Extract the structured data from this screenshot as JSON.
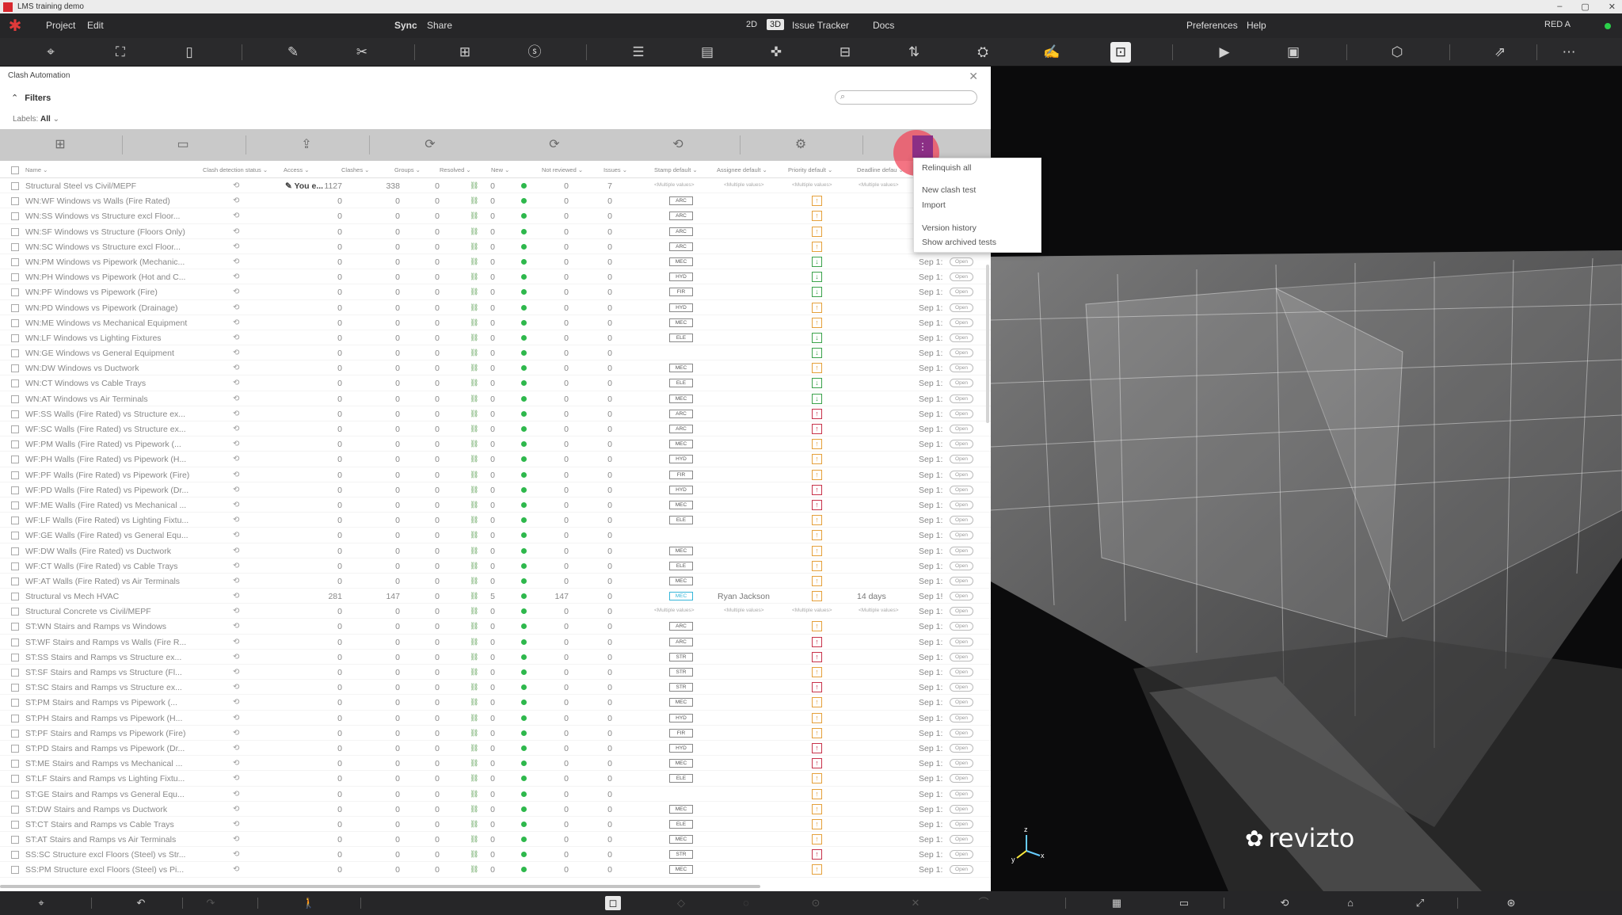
{
  "window": {
    "title": "LMS training demo",
    "controls": [
      "–",
      "▢",
      "✕"
    ]
  },
  "menubar": {
    "left": [
      "Project",
      "Edit"
    ],
    "center": [
      "Sync",
      "Share"
    ],
    "mode": [
      "2D",
      "3D"
    ],
    "nav": [
      "Issue Tracker",
      "Docs"
    ],
    "right": [
      "Preferences",
      "Help"
    ],
    "user": "RED A"
  },
  "toolbar": {
    "icons": [
      "map-pin-icon",
      "map-icon",
      "sheet-icon",
      "ruler-icon",
      "scissors-icon",
      "add-view-icon",
      "st-icon",
      "stack-icon",
      "list-icon",
      "gamepad-icon",
      "issues-icon",
      "sort-icon",
      "bucket-icon",
      "markup-icon",
      "clash-icon",
      "presentation-icon",
      "camera-icon",
      "cube-icon",
      "export-icon",
      "more-icon"
    ],
    "glyphs": [
      "⌖",
      "⛶",
      "▯",
      "✎",
      "✂",
      "⊞",
      "ⓢ",
      "☰",
      "▤",
      "✜",
      "⊟",
      "⇅",
      "⛭",
      "✍",
      "⊡",
      "▶",
      "▣",
      "⬡",
      "⇗",
      "⋯"
    ]
  },
  "panel": {
    "title": "Clash Automation",
    "filters_label": "Filters",
    "labels_prefix": "Labels:",
    "labels_value": "All",
    "search_placeholder": "",
    "columns": [
      "Name",
      "Clash detection status",
      "Access",
      "Clashes",
      "Groups",
      "Resolved",
      "New",
      "Not reviewed",
      "Issues",
      "Stamp default",
      "Assignee default",
      "Priority default",
      "Deadline defau"
    ]
  },
  "dropdown": {
    "items": [
      "Relinquish all",
      "New clash test",
      "Import",
      "Version history",
      "Show archived tests"
    ]
  },
  "rows": [
    {
      "name": "Structural Steel vs Civil/MEPF",
      "access": "You e...",
      "clashes": "1127",
      "groups": "338",
      "resolved": "0",
      "new": "0",
      "notrev": "0",
      "issues": "7",
      "stamp": "<Multiple values>",
      "assignee": "<Multiple values>",
      "priority": "mult",
      "deadline": "<Multiple values>",
      "date": "",
      "status": ""
    },
    {
      "name": "WN:WF Windows vs Walls (Fire Rated)",
      "clashes": "0",
      "groups": "0",
      "resolved": "0",
      "new": "0",
      "notrev": "0",
      "issues": "0",
      "stamp": "ARC",
      "priority": "up"
    },
    {
      "name": "WN:SS Windows vs Structure excl Floor...",
      "clashes": "0",
      "groups": "0",
      "resolved": "0",
      "new": "0",
      "notrev": "0",
      "issues": "0",
      "stamp": "ARC",
      "priority": "up"
    },
    {
      "name": "WN:SF Windows vs Structure (Floors Only)",
      "clashes": "0",
      "groups": "0",
      "resolved": "0",
      "new": "0",
      "notrev": "0",
      "issues": "0",
      "stamp": "ARC",
      "priority": "up"
    },
    {
      "name": "WN:SC Windows vs Structure excl Floor...",
      "clashes": "0",
      "groups": "0",
      "resolved": "0",
      "new": "0",
      "notrev": "0",
      "issues": "0",
      "stamp": "ARC",
      "priority": "up"
    },
    {
      "name": "WN:PM Windows vs Pipework (Mechanic...",
      "clashes": "0",
      "groups": "0",
      "resolved": "0",
      "new": "0",
      "notrev": "0",
      "issues": "0",
      "stamp": "MEC",
      "priority": "down",
      "date": "Sep 1:",
      "status": "Open"
    },
    {
      "name": "WN:PH Windows vs Pipework (Hot and C...",
      "clashes": "0",
      "groups": "0",
      "resolved": "0",
      "new": "0",
      "notrev": "0",
      "issues": "0",
      "stamp": "HYD",
      "priority": "down",
      "date": "Sep 1:",
      "status": "Open"
    },
    {
      "name": "WN:PF Windows vs Pipework (Fire)",
      "clashes": "0",
      "groups": "0",
      "resolved": "0",
      "new": "0",
      "notrev": "0",
      "issues": "0",
      "stamp": "FIR",
      "priority": "down",
      "date": "Sep 1:",
      "status": "Open"
    },
    {
      "name": "WN:PD Windows vs Pipework (Drainage)",
      "clashes": "0",
      "groups": "0",
      "resolved": "0",
      "new": "0",
      "notrev": "0",
      "issues": "0",
      "stamp": "HYD",
      "priority": "up",
      "date": "Sep 1:",
      "status": "Open"
    },
    {
      "name": "WN:ME Windows vs Mechanical Equipment",
      "clashes": "0",
      "groups": "0",
      "resolved": "0",
      "new": "0",
      "notrev": "0",
      "issues": "0",
      "stamp": "MEC",
      "priority": "up",
      "date": "Sep 1:",
      "status": "Open"
    },
    {
      "name": "WN:LF Windows vs Lighting Fixtures",
      "clashes": "0",
      "groups": "0",
      "resolved": "0",
      "new": "0",
      "notrev": "0",
      "issues": "0",
      "stamp": "ELE",
      "priority": "down",
      "date": "Sep 1:",
      "status": "Open"
    },
    {
      "name": "WN:GE Windows vs General Equipment",
      "clashes": "0",
      "groups": "0",
      "resolved": "0",
      "new": "0",
      "notrev": "0",
      "issues": "0",
      "stamp": "",
      "priority": "down",
      "date": "Sep 1:",
      "status": "Open"
    },
    {
      "name": "WN:DW Windows vs Ductwork",
      "clashes": "0",
      "groups": "0",
      "resolved": "0",
      "new": "0",
      "notrev": "0",
      "issues": "0",
      "stamp": "MEC",
      "priority": "up",
      "date": "Sep 1:",
      "status": "Open"
    },
    {
      "name": "WN:CT Windows vs Cable Trays",
      "clashes": "0",
      "groups": "0",
      "resolved": "0",
      "new": "0",
      "notrev": "0",
      "issues": "0",
      "stamp": "ELE",
      "priority": "down",
      "date": "Sep 1:",
      "status": "Open"
    },
    {
      "name": "WN:AT Windows vs Air Terminals",
      "clashes": "0",
      "groups": "0",
      "resolved": "0",
      "new": "0",
      "notrev": "0",
      "issues": "0",
      "stamp": "MEC",
      "priority": "down",
      "date": "Sep 1:",
      "status": "Open"
    },
    {
      "name": "WF:SS Walls (Fire Rated) vs Structure ex...",
      "clashes": "0",
      "groups": "0",
      "resolved": "0",
      "new": "0",
      "notrev": "0",
      "issues": "0",
      "stamp": "ARC",
      "priority": "high",
      "date": "Sep 1:",
      "status": "Open"
    },
    {
      "name": "WF:SC Walls (Fire Rated) vs Structure ex...",
      "clashes": "0",
      "groups": "0",
      "resolved": "0",
      "new": "0",
      "notrev": "0",
      "issues": "0",
      "stamp": "ARC",
      "priority": "high",
      "date": "Sep 1:",
      "status": "Open"
    },
    {
      "name": "WF:PM Walls (Fire Rated) vs Pipework (...",
      "clashes": "0",
      "groups": "0",
      "resolved": "0",
      "new": "0",
      "notrev": "0",
      "issues": "0",
      "stamp": "MEC",
      "priority": "up",
      "date": "Sep 1:",
      "status": "Open"
    },
    {
      "name": "WF:PH Walls (Fire Rated) vs Pipework (H...",
      "clashes": "0",
      "groups": "0",
      "resolved": "0",
      "new": "0",
      "notrev": "0",
      "issues": "0",
      "stamp": "HYD",
      "priority": "up",
      "date": "Sep 1:",
      "status": "Open"
    },
    {
      "name": "WF:PF Walls (Fire Rated) vs Pipework (Fire)",
      "clashes": "0",
      "groups": "0",
      "resolved": "0",
      "new": "0",
      "notrev": "0",
      "issues": "0",
      "stamp": "FIR",
      "priority": "up",
      "date": "Sep 1:",
      "status": "Open"
    },
    {
      "name": "WF:PD Walls (Fire Rated) vs Pipework (Dr...",
      "clashes": "0",
      "groups": "0",
      "resolved": "0",
      "new": "0",
      "notrev": "0",
      "issues": "0",
      "stamp": "HYD",
      "priority": "high",
      "date": "Sep 1:",
      "status": "Open"
    },
    {
      "name": "WF:ME Walls (Fire Rated) vs Mechanical ...",
      "clashes": "0",
      "groups": "0",
      "resolved": "0",
      "new": "0",
      "notrev": "0",
      "issues": "0",
      "stamp": "MEC",
      "priority": "high",
      "date": "Sep 1:",
      "status": "Open"
    },
    {
      "name": "WF:LF Walls (Fire Rated) vs Lighting Fixtu...",
      "clashes": "0",
      "groups": "0",
      "resolved": "0",
      "new": "0",
      "notrev": "0",
      "issues": "0",
      "stamp": "ELE",
      "priority": "up",
      "date": "Sep 1:",
      "status": "Open"
    },
    {
      "name": "WF:GE Walls (Fire Rated) vs General Equ...",
      "clashes": "0",
      "groups": "0",
      "resolved": "0",
      "new": "0",
      "notrev": "0",
      "issues": "0",
      "stamp": "",
      "priority": "up",
      "date": "Sep 1:",
      "status": "Open"
    },
    {
      "name": "WF:DW Walls (Fire Rated) vs Ductwork",
      "clashes": "0",
      "groups": "0",
      "resolved": "0",
      "new": "0",
      "notrev": "0",
      "issues": "0",
      "stamp": "MEC",
      "priority": "up",
      "date": "Sep 1:",
      "status": "Open"
    },
    {
      "name": "WF:CT Walls (Fire Rated) vs Cable Trays",
      "clashes": "0",
      "groups": "0",
      "resolved": "0",
      "new": "0",
      "notrev": "0",
      "issues": "0",
      "stamp": "ELE",
      "priority": "up",
      "date": "Sep 1:",
      "status": "Open"
    },
    {
      "name": "WF:AT Walls (Fire Rated) vs Air Terminals",
      "clashes": "0",
      "groups": "0",
      "resolved": "0",
      "new": "0",
      "notrev": "0",
      "issues": "0",
      "stamp": "MEC",
      "priority": "up",
      "date": "Sep 1:",
      "status": "Open"
    },
    {
      "name": "Structural vs Mech HVAC",
      "clashes": "281",
      "groups": "147",
      "resolved": "0",
      "new": "5",
      "notrev": "147",
      "issues": "0",
      "stamp": "MEC",
      "stampSel": true,
      "assignee": "Ryan Jackson",
      "priority": "up",
      "deadline": "14 days",
      "date": "Sep 1!",
      "status": "Open"
    },
    {
      "name": "Structural Concrete vs Civil/MEPF",
      "clashes": "0",
      "groups": "0",
      "resolved": "0",
      "new": "0",
      "notrev": "0",
      "issues": "0",
      "stamp": "<Multiple values>",
      "assignee": "<Multiple values>",
      "priority": "mult",
      "deadline": "<Multiple values>",
      "date": "Sep 1:",
      "status": "Open"
    },
    {
      "name": "ST:WN Stairs and Ramps vs Windows",
      "clashes": "0",
      "groups": "0",
      "resolved": "0",
      "new": "0",
      "notrev": "0",
      "issues": "0",
      "stamp": "ARC",
      "priority": "up",
      "date": "Sep 1:",
      "status": "Open"
    },
    {
      "name": "ST:WF Stairs and Ramps vs Walls (Fire R...",
      "clashes": "0",
      "groups": "0",
      "resolved": "0",
      "new": "0",
      "notrev": "0",
      "issues": "0",
      "stamp": "ARC",
      "priority": "high",
      "date": "Sep 1:",
      "status": "Open"
    },
    {
      "name": "ST:SS Stairs and Ramps vs Structure ex...",
      "clashes": "0",
      "groups": "0",
      "resolved": "0",
      "new": "0",
      "notrev": "0",
      "issues": "0",
      "stamp": "STR",
      "priority": "high",
      "date": "Sep 1:",
      "status": "Open"
    },
    {
      "name": "ST:SF Stairs and Ramps vs Structure (Fl...",
      "clashes": "0",
      "groups": "0",
      "resolved": "0",
      "new": "0",
      "notrev": "0",
      "issues": "0",
      "stamp": "STR",
      "priority": "up",
      "date": "Sep 1:",
      "status": "Open"
    },
    {
      "name": "ST:SC Stairs and Ramps vs Structure ex...",
      "clashes": "0",
      "groups": "0",
      "resolved": "0",
      "new": "0",
      "notrev": "0",
      "issues": "0",
      "stamp": "STR",
      "priority": "high",
      "date": "Sep 1:",
      "status": "Open"
    },
    {
      "name": "ST:PM Stairs and Ramps vs Pipework (...",
      "clashes": "0",
      "groups": "0",
      "resolved": "0",
      "new": "0",
      "notrev": "0",
      "issues": "0",
      "stamp": "MEC",
      "priority": "up",
      "date": "Sep 1:",
      "status": "Open"
    },
    {
      "name": "ST:PH Stairs and Ramps vs Pipework (H...",
      "clashes": "0",
      "groups": "0",
      "resolved": "0",
      "new": "0",
      "notrev": "0",
      "issues": "0",
      "stamp": "HYD",
      "priority": "up",
      "date": "Sep 1:",
      "status": "Open"
    },
    {
      "name": "ST:PF Stairs and Ramps vs Pipework (Fire)",
      "clashes": "0",
      "groups": "0",
      "resolved": "0",
      "new": "0",
      "notrev": "0",
      "issues": "0",
      "stamp": "FIR",
      "priority": "up",
      "date": "Sep 1:",
      "status": "Open"
    },
    {
      "name": "ST:PD Stairs and Ramps vs Pipework (Dr...",
      "clashes": "0",
      "groups": "0",
      "resolved": "0",
      "new": "0",
      "notrev": "0",
      "issues": "0",
      "stamp": "HYD",
      "priority": "high",
      "date": "Sep 1:",
      "status": "Open"
    },
    {
      "name": "ST:ME Stairs and Ramps vs Mechanical ...",
      "clashes": "0",
      "groups": "0",
      "resolved": "0",
      "new": "0",
      "notrev": "0",
      "issues": "0",
      "stamp": "MEC",
      "priority": "high",
      "date": "Sep 1:",
      "status": "Open"
    },
    {
      "name": "ST:LF Stairs and Ramps vs Lighting Fixtu...",
      "clashes": "0",
      "groups": "0",
      "resolved": "0",
      "new": "0",
      "notrev": "0",
      "issues": "0",
      "stamp": "ELE",
      "priority": "up",
      "date": "Sep 1:",
      "status": "Open"
    },
    {
      "name": "ST:GE Stairs and Ramps vs General Equ...",
      "clashes": "0",
      "groups": "0",
      "resolved": "0",
      "new": "0",
      "notrev": "0",
      "issues": "0",
      "stamp": "",
      "priority": "up",
      "date": "Sep 1:",
      "status": "Open"
    },
    {
      "name": "ST:DW Stairs and Ramps vs Ductwork",
      "clashes": "0",
      "groups": "0",
      "resolved": "0",
      "new": "0",
      "notrev": "0",
      "issues": "0",
      "stamp": "MEC",
      "priority": "up",
      "date": "Sep 1:",
      "status": "Open"
    },
    {
      "name": "ST:CT Stairs and Ramps vs Cable Trays",
      "clashes": "0",
      "groups": "0",
      "resolved": "0",
      "new": "0",
      "notrev": "0",
      "issues": "0",
      "stamp": "ELE",
      "priority": "up",
      "date": "Sep 1:",
      "status": "Open"
    },
    {
      "name": "ST:AT Stairs and Ramps vs Air Terminals",
      "clashes": "0",
      "groups": "0",
      "resolved": "0",
      "new": "0",
      "notrev": "0",
      "issues": "0",
      "stamp": "MEC",
      "priority": "up",
      "date": "Sep 1:",
      "status": "Open"
    },
    {
      "name": "SS:SC Structure excl Floors (Steel) vs Str...",
      "clashes": "0",
      "groups": "0",
      "resolved": "0",
      "new": "0",
      "notrev": "0",
      "issues": "0",
      "stamp": "STR",
      "priority": "high",
      "date": "Sep 1:",
      "status": "Open"
    },
    {
      "name": "SS:PM Structure excl Floors (Steel) vs Pi...",
      "clashes": "0",
      "groups": "0",
      "resolved": "0",
      "new": "0",
      "notrev": "0",
      "issues": "0",
      "stamp": "MEC",
      "priority": "up",
      "date": "Sep 1:",
      "status": "Open"
    }
  ],
  "viewport": {
    "brand": "revizto"
  },
  "bottombar": {
    "icons": [
      "pin-icon",
      "undo-icon",
      "redo-icon",
      "walk-icon",
      "cursor-icon",
      "tool-a-icon",
      "tool-b-icon",
      "tool-c-icon",
      "tool-d-icon",
      "tool-e-icon",
      "grid-icon",
      "comment-icon",
      "orbit-icon",
      "home-icon",
      "fit-icon",
      "layers-icon"
    ],
    "glyphs": [
      "⌖",
      "↶",
      "↷",
      "🚶",
      "◻",
      "◇",
      "◌",
      "⊙",
      "✕",
      "⌒",
      "▦",
      "▭",
      "⟲",
      "⌂",
      "⤢",
      "⊛"
    ]
  },
  "colors": {
    "accent_purple": "#8b2f85",
    "brand_red": "#d8282f",
    "ok_green": "#2eb84c"
  }
}
